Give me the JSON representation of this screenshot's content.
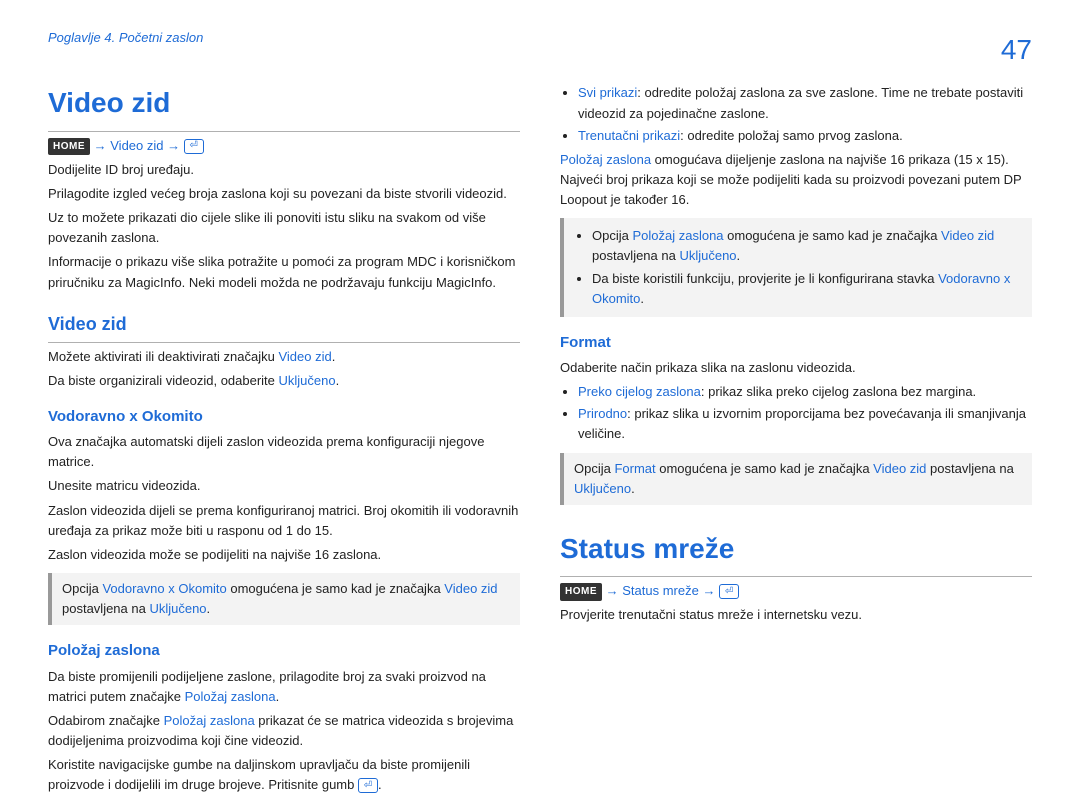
{
  "header": {
    "chapter": "Poglavlje 4. Početni zaslon",
    "pageNumber": "47"
  },
  "badges": {
    "home": "HOME",
    "arrow": "→"
  },
  "left": {
    "title": "Video zid",
    "navVideoZid": "Video zid",
    "p1": "Dodijelite ID broj uređaju.",
    "p2": "Prilagodite izgled većeg broja zaslona koji su povezani da biste stvorili videozid.",
    "p3": "Uz to možete prikazati dio cijele slike ili ponoviti istu sliku na svakom od više povezanih zaslona.",
    "p4": "Informacije o prikazu više slika potražite u pomoći za program MDC i korisničkom priručniku za MagicInfo. Neki modeli možda ne podržavaju funkciju MagicInfo.",
    "s1": {
      "heading": "Video zid",
      "p1a": "Možete aktivirati ili deaktivirati značajku ",
      "p1b": "Video zid",
      "p1c": ".",
      "p2a": "Da biste organizirali videozid, odaberite ",
      "p2b": "Uključeno",
      "p2c": "."
    },
    "s2": {
      "heading": "Vodoravno x Okomito",
      "p1": "Ova značajka automatski dijeli zaslon videozida prema konfiguraciji njegove matrice.",
      "p2": "Unesite matricu videozida.",
      "p3": "Zaslon videozida dijeli se prema konfiguriranoj matrici. Broj okomitih ili vodoravnih uređaja za prikaz može biti u rasponu od 1 do 15.",
      "p4": "Zaslon videozida može se podijeliti na najviše 16 zaslona.",
      "note": {
        "a": "Opcija ",
        "b": "Vodoravno x Okomito",
        "c": " omogućena je samo kad je značajka ",
        "d": "Video zid",
        "e": " postavljena na ",
        "f": "Uključeno",
        "g": "."
      }
    },
    "s3": {
      "heading": "Položaj zaslona",
      "p1a": "Da biste promijenili podijeljene zaslone, prilagodite broj za svaki proizvod na matrici putem značajke ",
      "p1b": "Položaj zaslona",
      "p1c": ".",
      "p2a": "Odabirom značajke ",
      "p2b": "Položaj zaslona",
      "p2c": " prikazat će se matrica videozida s brojevima dodijeljenima proizvodima koji čine videozid.",
      "p3a": "Koristite navigacijske gumbe na daljinskom upravljaču da biste promijenili proizvode i dodijelili im druge brojeve. Pritisnite gumb ",
      "p3b": "."
    }
  },
  "right": {
    "bullets1": {
      "b1a": "Svi prikazi",
      "b1b": ": odredite položaj zaslona za sve zaslone. Time ne trebate postaviti videozid za pojedinačne zaslone.",
      "b2a": "Trenutačni prikazi",
      "b2b": ": odredite položaj samo prvog zaslona."
    },
    "p1a": "Položaj zaslona",
    "p1b": " omogućava dijeljenje zaslona na najviše 16 prikaza (15 x 15). Najveći broj prikaza koji se može podijeliti kada su proizvodi povezani putem DP Loopout je također 16.",
    "note1": {
      "li1a": "Opcija ",
      "li1b": "Položaj zaslona",
      "li1c": " omogućena je samo kad je značajka ",
      "li1d": "Video zid",
      "li1e": " postavljena na ",
      "li1f": "Uključeno",
      "li1g": ".",
      "li2a": "Da biste koristili funkciju, provjerite je li konfigurirana stavka ",
      "li2b": "Vodoravno x Okomito",
      "li2c": "."
    },
    "s4": {
      "heading": "Format",
      "p1": "Odaberite način prikaza slika na zaslonu videozida.",
      "b1a": "Preko cijelog zaslona",
      "b1b": ": prikaz slika preko cijelog zaslona bez margina.",
      "b2a": "Prirodno",
      "b2b": ": prikaz slika u izvornim proporcijama bez povećavanja ili smanjivanja veličine.",
      "note": {
        "a": "Opcija ",
        "b": "Format",
        "c": " omogućena je samo kad je značajka ",
        "d": "Video zid",
        "e": " postavljena na ",
        "f": "Uključeno",
        "g": "."
      }
    },
    "status": {
      "title": "Status mreže",
      "nav": "Status mreže",
      "p1": "Provjerite trenutačni status mreže i internetsku vezu."
    }
  }
}
